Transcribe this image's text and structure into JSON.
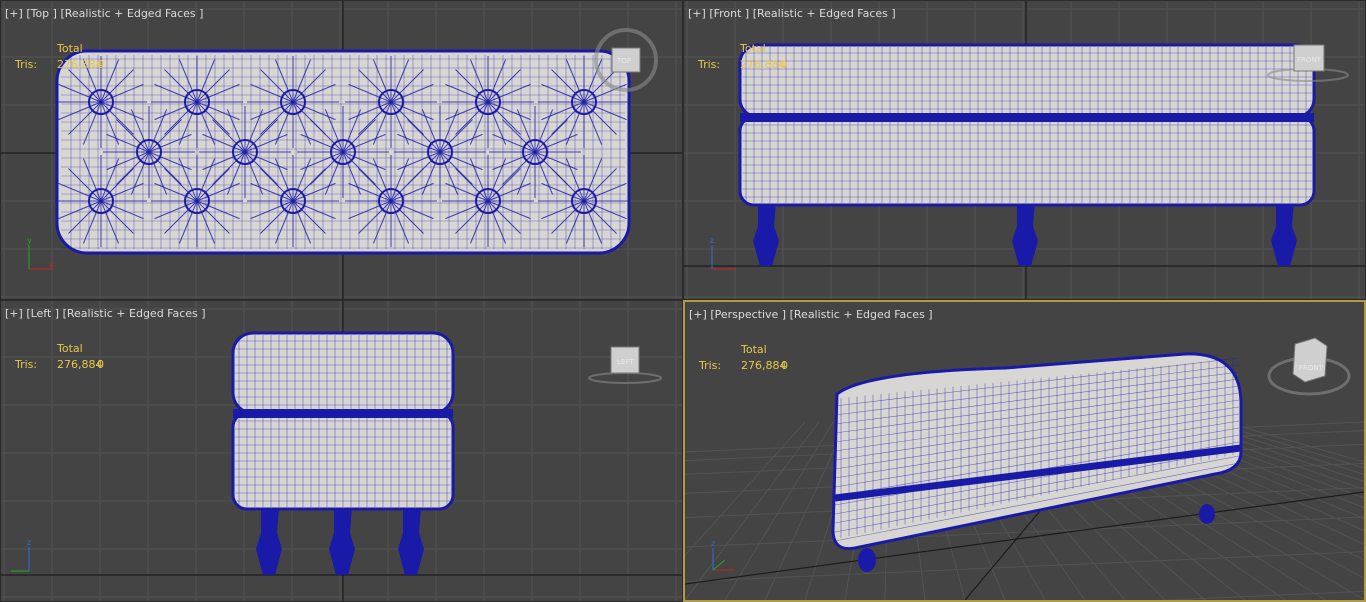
{
  "viewports": [
    {
      "id": "top",
      "plus": "[+]",
      "view": "[Top ]",
      "shading": "[Realistic + Edged Faces ]",
      "stats": {
        "total_label": "Total",
        "tris_label": "Tris:",
        "tris_value": "276,884",
        "tris_selected": "0"
      },
      "viewcube": "TOP"
    },
    {
      "id": "front",
      "plus": "[+]",
      "view": "[Front ]",
      "shading": "[Realistic + Edged Faces ]",
      "stats": {
        "total_label": "Total",
        "tris_label": "Tris:",
        "tris_value": "276,884",
        "tris_selected": "0"
      },
      "viewcube": "FRONT"
    },
    {
      "id": "left",
      "plus": "[+]",
      "view": "[Left ]",
      "shading": "[Realistic + Edged Faces ]",
      "stats": {
        "total_label": "Total",
        "tris_label": "Tris:",
        "tris_value": "276,884",
        "tris_selected": "0"
      },
      "viewcube": "LEFT"
    },
    {
      "id": "perspective",
      "plus": "[+]",
      "view": "[Perspective ]",
      "shading": "[Realistic + Edged Faces ]",
      "stats": {
        "total_label": "Total",
        "tris_label": "Tris:",
        "tris_value": "276,884",
        "tris_selected": "0"
      },
      "viewcube": "FRONT"
    }
  ],
  "colors": {
    "viewport_bg": "#444444",
    "grid_line": "#535353",
    "grid_axis": "#1c1c1c",
    "mesh_wire": "#1a1aa8",
    "mesh_fill": "#d8d6d2",
    "stats_text": "#e6c84a",
    "active_border": "#b39b45"
  }
}
